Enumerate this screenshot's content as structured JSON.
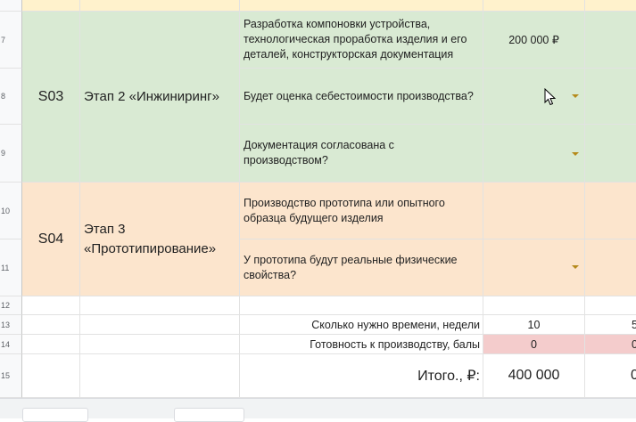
{
  "rows": {
    "r7": "7",
    "r8": "8",
    "r9": "9",
    "r10": "10",
    "r11": "11",
    "r12": "12",
    "r13": "13",
    "r14": "14",
    "r15": "15"
  },
  "stage_s03": {
    "code": "S03",
    "name": "Этап 2 «Инжиниринг»",
    "items": [
      {
        "text": "Разработка компоновки устройства, технологическая проработка изделия и его деталей, конструкторская документация",
        "value": "200 000 ₽"
      },
      {
        "text": "Будет оценка себестоимости производства?",
        "value": ""
      },
      {
        "text": "Документация согласована с производством?",
        "value": ""
      }
    ]
  },
  "stage_s04": {
    "code": "S04",
    "name": "Этап 3 «Прототипирование»",
    "items": [
      {
        "text": "Производство прототипа или опытного образца будущего изделия",
        "value": ""
      },
      {
        "text": "У прототипа будут реальные физические свойства?",
        "value": ""
      }
    ]
  },
  "summary": {
    "time_label": "Сколько нужно времени, недели",
    "time_value": "10",
    "time_next": "5",
    "ready_label": "Готовность к производству, балы",
    "ready_value": "0",
    "ready_next": "0",
    "total_label": "Итого., ₽:",
    "total_value": "400 000",
    "total_next": "0"
  },
  "colors": {
    "green": "#d9ead3",
    "peach": "#fce5cd",
    "pink": "#f4cccc",
    "yellow": "#fff2cc",
    "dropdown": "#b58a1b"
  },
  "icons": [
    "dropdown-arrow-icon",
    "cursor-icon"
  ]
}
